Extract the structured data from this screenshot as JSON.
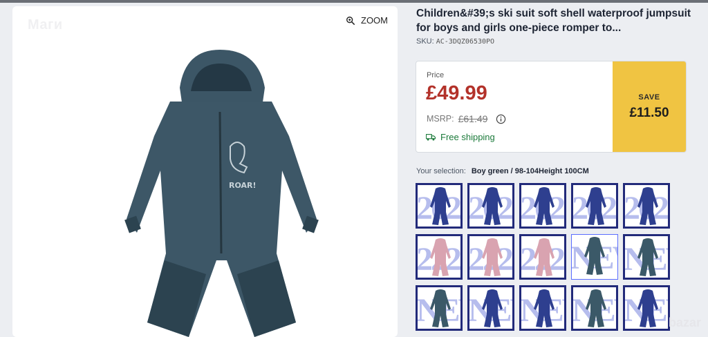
{
  "watermark_top": "Маги",
  "zoom": {
    "label": "ZOOM",
    "icon": "zoom-icon"
  },
  "product": {
    "title": "Children&#39;s ski suit soft shell waterproof jumpsuit for boys and girls one-piece romper to...",
    "sku_label": "SKU:",
    "sku": "AC-3DQZ06530PO"
  },
  "price": {
    "label": "Price",
    "value": "£49.99",
    "msrp_label": "MSRP:",
    "msrp_value": "£61.49",
    "shipping": "Free shipping",
    "save_label": "SAVE",
    "save_value": "£11.50"
  },
  "selection": {
    "label": "Your selection:",
    "value": "Boy green / 98-104Height 100CM"
  },
  "thumbnails": [
    {
      "overlay": "2020",
      "color": "#2e3f8f"
    },
    {
      "overlay": "2020",
      "color": "#2e3f8f"
    },
    {
      "overlay": "2020",
      "color": "#2e3f8f"
    },
    {
      "overlay": "2020",
      "color": "#2e3f8f"
    },
    {
      "overlay": "2020",
      "color": "#2e3f8f"
    },
    {
      "overlay": "2222",
      "color": "#d9a3b0"
    },
    {
      "overlay": "2222",
      "color": "#d9a3b0"
    },
    {
      "overlay": "2222",
      "color": "#d9a3b0"
    },
    {
      "overlay": "NEW",
      "color": "#3b5968"
    },
    {
      "overlay": "NEW",
      "color": "#3b5968"
    },
    {
      "overlay": "NEW",
      "color": "#3b5968"
    },
    {
      "overlay": "NEW",
      "color": "#2e3f8f"
    },
    {
      "overlay": "NEW",
      "color": "#2e3f8f"
    },
    {
      "overlay": "NEW",
      "color": "#3b5968"
    },
    {
      "overlay": "NEW",
      "color": "#2e3f8f"
    }
  ],
  "selected_thumbnail_index": 8,
  "colors": {
    "price": "#b3322a",
    "save_bg": "#f0c442",
    "shipping": "#1b7a3a",
    "thumb_border": "#222a7a"
  },
  "site_mark": "bazar"
}
